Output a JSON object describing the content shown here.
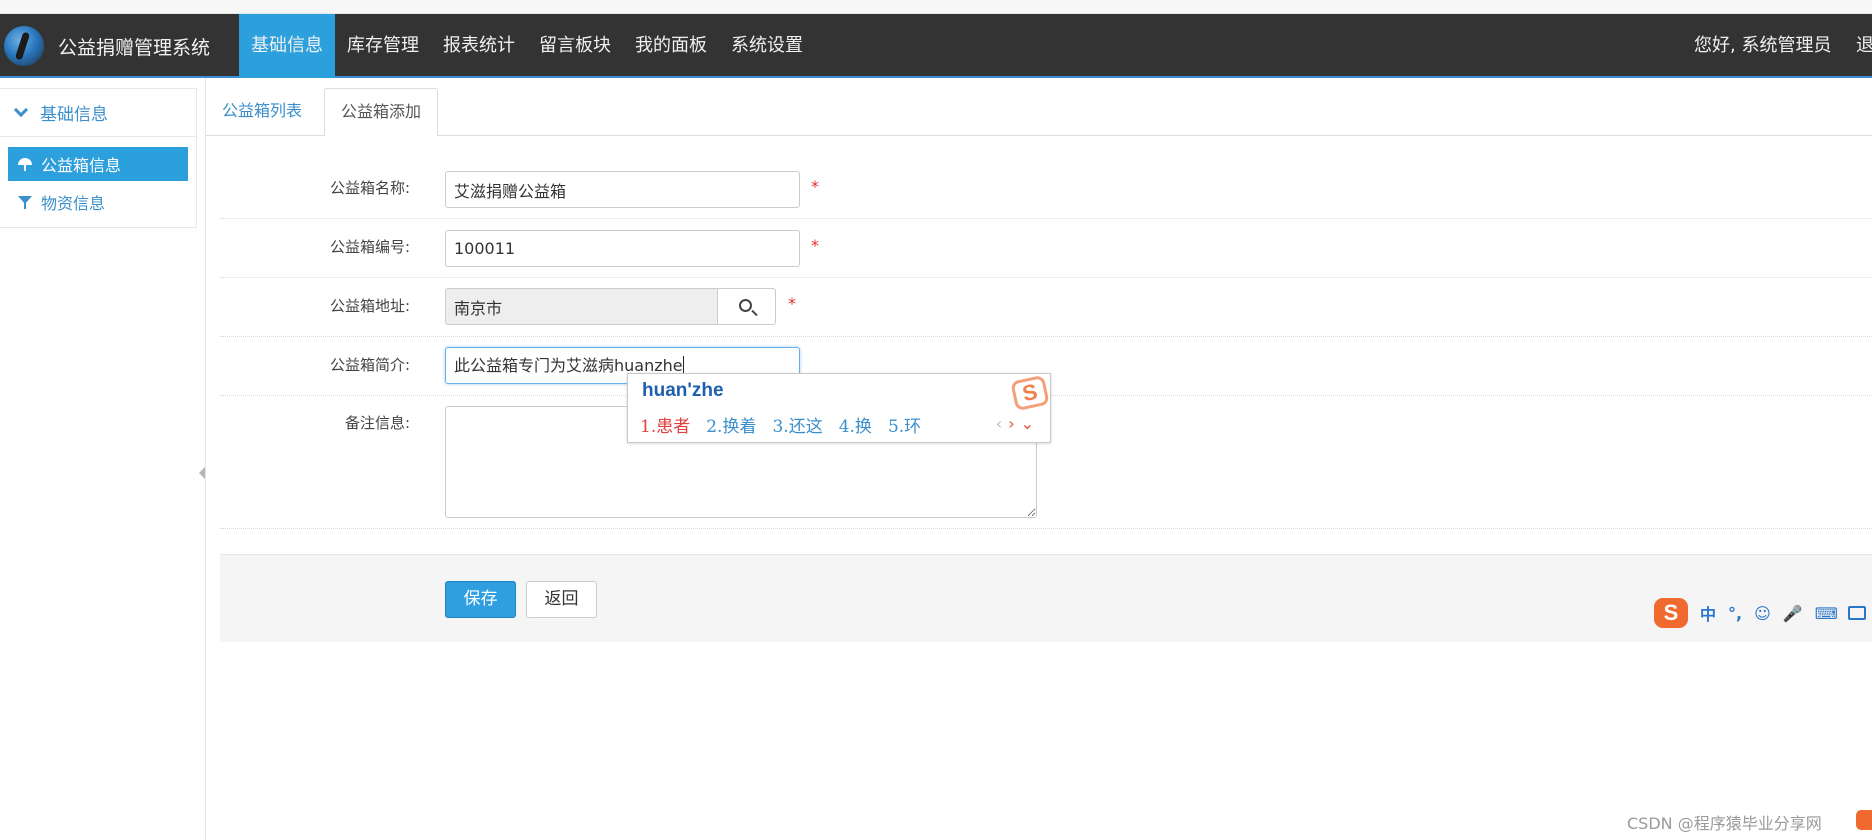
{
  "app": {
    "title": "公益捐赠管理系统",
    "greeting": "您好, 系统管理员",
    "logout_label": "退出"
  },
  "nav": {
    "items": [
      {
        "label": "基础信息",
        "active": true
      },
      {
        "label": "库存管理"
      },
      {
        "label": "报表统计"
      },
      {
        "label": "留言板块"
      },
      {
        "label": "我的面板"
      },
      {
        "label": "系统设置"
      }
    ]
  },
  "sidebar": {
    "section_title": "基础信息",
    "items": [
      {
        "label": "公益箱信息",
        "icon": "umbrella-icon",
        "active": true
      },
      {
        "label": "物资信息",
        "icon": "filter-icon"
      }
    ]
  },
  "tabs": [
    {
      "label": "公益箱列表"
    },
    {
      "label": "公益箱添加",
      "active": true
    }
  ],
  "form": {
    "name": {
      "label": "公益箱名称:",
      "value": "艾滋捐赠公益箱",
      "required": "*"
    },
    "code": {
      "label": "公益箱编号:",
      "value": "100011",
      "required": "*"
    },
    "address": {
      "label": "公益箱地址:",
      "value": "南京市",
      "required": "*"
    },
    "intro": {
      "label": "公益箱简介:",
      "value": "此公益箱专门为艾滋病huanzhe"
    },
    "remark": {
      "label": "备注信息:",
      "value": ""
    }
  },
  "ime": {
    "pinyin": "huan'zhe",
    "candidates": [
      "1.患者",
      "2.换着",
      "3.还这",
      "4.换",
      "5.环"
    ],
    "logo": "S",
    "toolbar": [
      "中",
      "°,",
      "☺",
      "🎤",
      "⌨"
    ]
  },
  "buttons": {
    "save": "保存",
    "back": "返回"
  },
  "watermark": "CSDN @程序猿毕业分享网"
}
